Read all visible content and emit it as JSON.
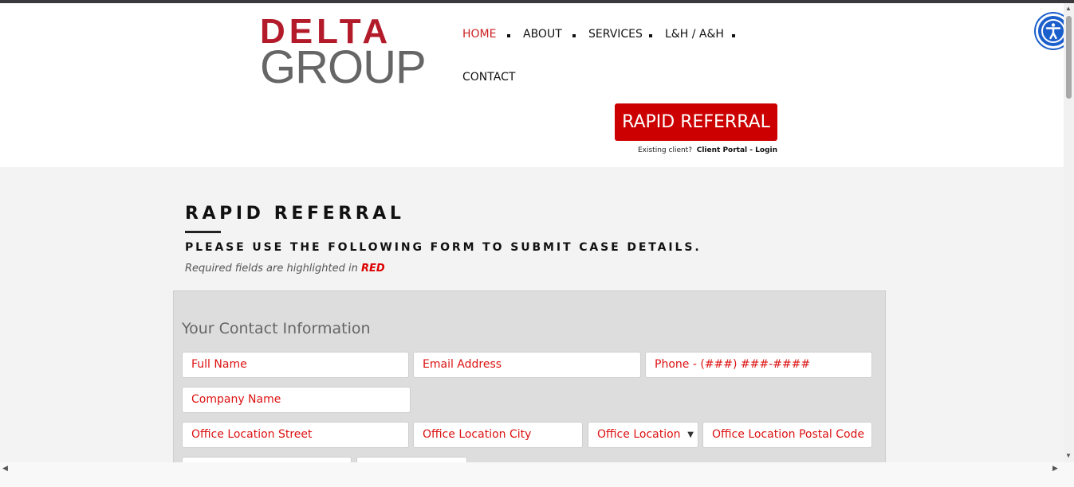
{
  "brand": {
    "logo_top": "DELTA",
    "logo_bottom": "GROUP",
    "red": "#b31b2b",
    "gray": "#666666"
  },
  "nav": {
    "items": [
      "HOME",
      "ABOUT",
      "SERVICES",
      "L&H / A&H",
      "CONTACT"
    ],
    "active": "HOME",
    "active_color": "#cc1f1f"
  },
  "cta": {
    "rapid_referral": "RAPID REFERRAL",
    "existing_prefix": "Existing client?",
    "portal_link": "Client Portal - Login",
    "color": "#cc0000"
  },
  "page": {
    "title": "RAPID REFERRAL",
    "subtitle": "PLEASE USE THE FOLLOWING FORM TO SUBMIT CASE DETAILS.",
    "required_note": "Required fields are highlighted in",
    "required_word": "RED"
  },
  "form": {
    "section_title": "Your Contact Information",
    "fields": {
      "full_name": "Full Name",
      "email": "Email Address",
      "phone": "Phone - (###) ###-####",
      "company": "Company Name",
      "street": "Office Location Street",
      "city": "Office Location City",
      "state": "Office Location",
      "postal": "Office Location Postal Code"
    }
  },
  "accessibility": {
    "icon": "accessibility-icon",
    "color": "#1b5fcc"
  }
}
